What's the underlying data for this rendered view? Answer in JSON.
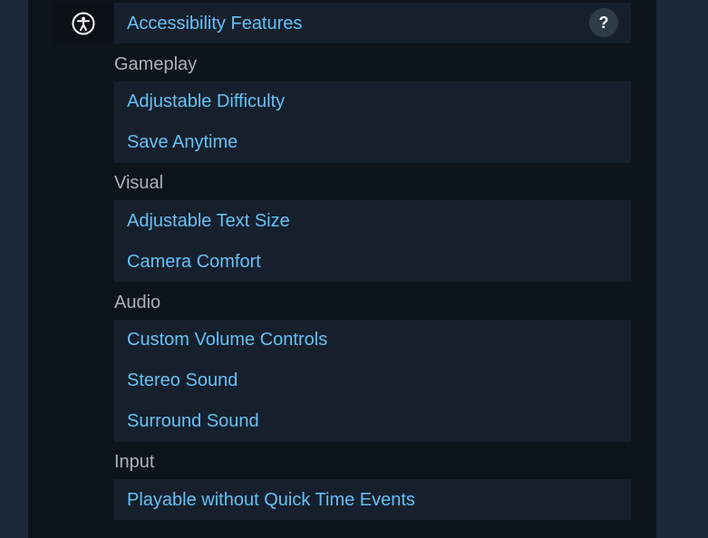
{
  "header": {
    "icon": "accessibility-icon",
    "title": "Accessibility Features",
    "help_label": "?"
  },
  "groups": [
    {
      "label": "Gameplay",
      "items": [
        "Adjustable Difficulty",
        "Save Anytime"
      ]
    },
    {
      "label": "Visual",
      "items": [
        "Adjustable Text Size",
        "Camera Comfort"
      ]
    },
    {
      "label": "Audio",
      "items": [
        "Custom Volume Controls",
        "Stereo Sound",
        "Surround Sound"
      ]
    },
    {
      "label": "Input",
      "items": [
        "Playable without Quick Time Events"
      ]
    }
  ],
  "colors": {
    "link": "#66c0f4",
    "label": "#acb2b8",
    "box": "#16202d",
    "panel": "#0e141b",
    "page": "#1b2838"
  }
}
